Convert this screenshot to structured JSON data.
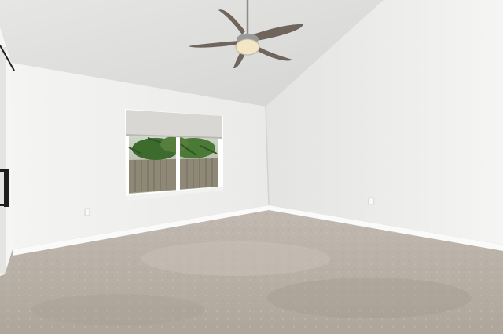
{
  "scene": {
    "description_alt": "",
    "colors": {
      "ceiling": "#e9e9e7",
      "left_wall": "#f1f1ef",
      "right_wall": "#ededeb",
      "baseboard": "#fafafa",
      "carpet": "#b9b0a6",
      "carpet_dark": "#a79e94",
      "fan_blade": "#6f655d",
      "fan_metal": "#8c8c8a",
      "fan_light": "#f3e6c4",
      "window_frame": "#ffffff",
      "blind": "#dcdad6",
      "fence": "#8e8778",
      "palm": "#3f6b2e",
      "door_frame": "#fbfbfb",
      "door_handle": "#1e1e1e"
    },
    "objects": {
      "ceiling_fan": "ceiling-fan",
      "window": "window",
      "outlets": 2,
      "door": "door-partial"
    }
  }
}
